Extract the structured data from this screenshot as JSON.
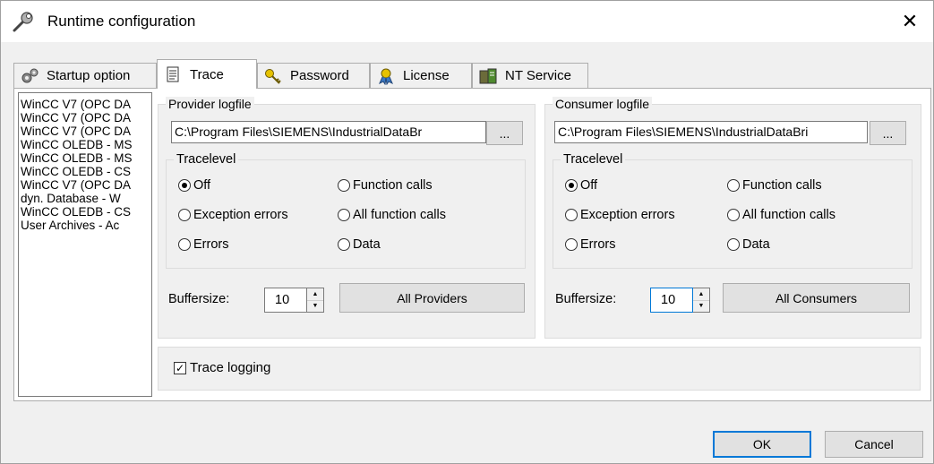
{
  "window": {
    "title": "Runtime configuration"
  },
  "tabs": [
    {
      "label": "Startup option",
      "icon": "gears-icon"
    },
    {
      "label": "Trace",
      "icon": "notepad-icon",
      "active": true
    },
    {
      "label": "Password",
      "icon": "keys-icon"
    },
    {
      "label": "License",
      "icon": "certificate-icon"
    },
    {
      "label": "NT Service",
      "icon": "server-icon"
    }
  ],
  "connections": [
    "WinCC V7 (OPC DA",
    "WinCC V7 (OPC DA",
    "WinCC V7 (OPC DA",
    "WinCC OLEDB - MS",
    "WinCC OLEDB - MS",
    "WinCC OLEDB - CS",
    "WinCC V7 (OPC DA",
    "dyn. Database - W",
    "WinCC OLEDB - CS",
    "User Archives - Ac"
  ],
  "provider": {
    "group_label": "Provider logfile",
    "path": "C:\\Program Files\\SIEMENS\\IndustrialDataBr",
    "browse_label": "...",
    "tracelevel_label": "Tracelevel",
    "options": [
      "Off",
      "Function calls",
      "Exception errors",
      "All function calls",
      "Errors",
      "Data"
    ],
    "selected": "Off",
    "buffersize_label": "Buffersize:",
    "buffersize": "10",
    "all_button": "All Providers"
  },
  "consumer": {
    "group_label": "Consumer logfile",
    "path": "C:\\Program Files\\SIEMENS\\IndustrialDataBri",
    "browse_label": "...",
    "tracelevel_label": "Tracelevel",
    "options": [
      "Off",
      "Function calls",
      "Exception errors",
      "All function calls",
      "Errors",
      "Data"
    ],
    "selected": "Off",
    "buffersize_label": "Buffersize:",
    "buffersize": "10",
    "all_button": "All Consumers"
  },
  "trace_logging": {
    "label": "Trace logging",
    "checked": true
  },
  "footer": {
    "ok": "OK",
    "cancel": "Cancel"
  },
  "colors": {
    "accent": "#0078d7",
    "window_bg": "#f0f0f0",
    "panel_bg": "#ffffff"
  }
}
